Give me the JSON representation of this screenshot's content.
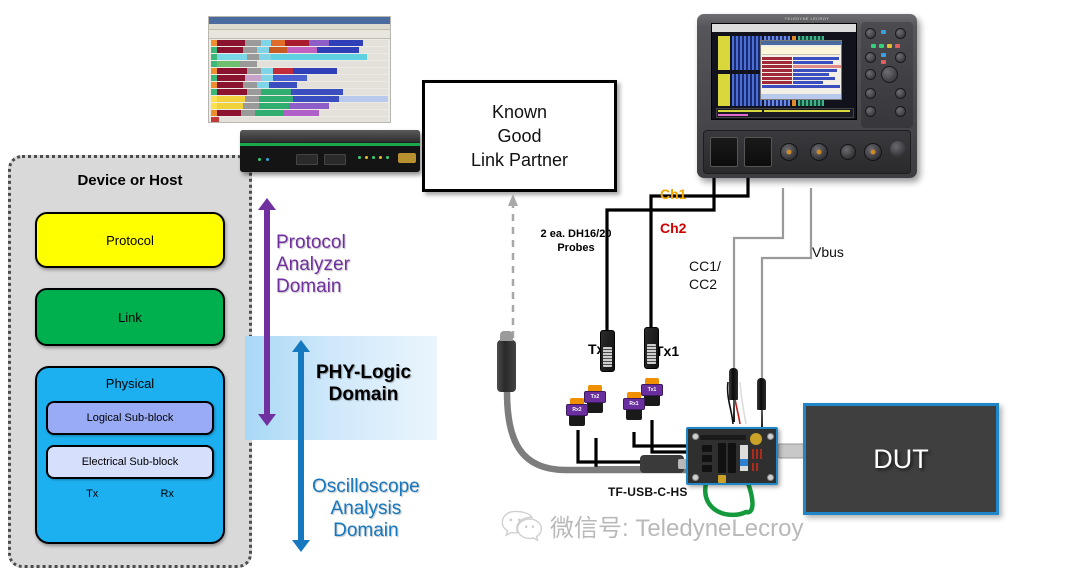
{
  "stack": {
    "title": "Device or Host",
    "layers": [
      {
        "label": "Protocol",
        "color": "#ffff00"
      },
      {
        "label": "Link",
        "color": "#00b04f"
      },
      {
        "label": "Physical",
        "color": "#1cb0f0"
      }
    ],
    "sub_blocks": [
      {
        "label": "Logical Sub-block",
        "color": "#9aabf6"
      },
      {
        "label": "Electrical Sub-block",
        "color": "#d6dffb"
      }
    ],
    "ports": {
      "tx": "Tx",
      "rx": "Rx"
    }
  },
  "domains": {
    "protocol": {
      "label": "Protocol\nAnalyzer\nDomain",
      "line1": "Protocol",
      "line2": "Analyzer",
      "line3": "Domain",
      "color": "#7030a0"
    },
    "phy": {
      "line1": "PHY-Logic",
      "line2": "Domain",
      "color": "#000000"
    },
    "scope": {
      "line1": "Oscilloscope",
      "line2": "Analysis",
      "line3": "Domain",
      "color": "#1679c0"
    }
  },
  "link_partner": {
    "line1": "Known",
    "line2": "Good",
    "line3": "Link Partner"
  },
  "scope_labels": {
    "ch1": "Ch1",
    "ch2": "Ch2",
    "ch1_color": "#f0a400",
    "ch2_color": "#d00000",
    "probes_line1": "2 ea. DH16/20",
    "probes_line2": "Probes",
    "cc_line1": "CC1/",
    "cc_line2": "CC2",
    "vbus": "Vbus",
    "tx1": "Tx1",
    "tx2": "Tx2"
  },
  "connectors": {
    "tx2_badge": "Tx2",
    "rx2_badge": "Rx2",
    "tx1_badge": "Tx1",
    "rx1_badge": "Rx1"
  },
  "fixture": {
    "label": "TF-USB-C-HS",
    "accent_color": "#1f86c8"
  },
  "dut": {
    "label": "DUT",
    "accent_color": "#1f86c8"
  },
  "watermark": {
    "text": "微信号: TeledyneLecroy",
    "icon": "wechat-icon",
    "color": "#b9b9b9"
  },
  "instruments": {
    "analyzer_name": "protocol-analyzer",
    "oscilloscope_name": "oscilloscope"
  }
}
